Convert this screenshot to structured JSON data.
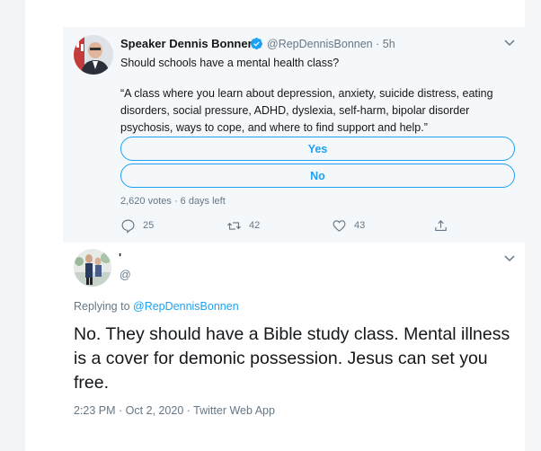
{
  "tweet": {
    "author_name": "Speaker Dennis Bonnen",
    "handle": "@RepDennisBonnen",
    "separator": "·",
    "time_ago": "5h",
    "question": "Should schools have a mental health class?",
    "quote": "“A class where you learn about depression, anxiety, suicide distress, eating disorders, social pressure, ADHD, dyslexia, self-harm, bipolar disorder psychosis, ways to cope, and where to find support and help.”",
    "poll": {
      "options": [
        "Yes",
        "No"
      ],
      "votes_text": "2,620 votes · 6 days left"
    },
    "actions": {
      "replies": "25",
      "retweets": "42",
      "likes": "43"
    }
  },
  "reply": {
    "author_name": "'",
    "handle": "@",
    "replying_prefix": "Replying to ",
    "replying_to": "@RepDennisBonnen",
    "text": "No. They should have a Bible study class. Mental illness is a cover for demonic possession. Jesus can set you free.",
    "meta": "2:23 PM · Oct 2, 2020 · Twitter Web App"
  },
  "icons": [
    "verified-badge-icon",
    "chevron-down-icon",
    "reply-icon",
    "retweet-icon",
    "like-icon",
    "share-icon"
  ],
  "colors": {
    "accent": "#1da1f2",
    "secondary_text": "#657786",
    "primary_text": "#14171a",
    "card_background": "#f5f8fa"
  }
}
